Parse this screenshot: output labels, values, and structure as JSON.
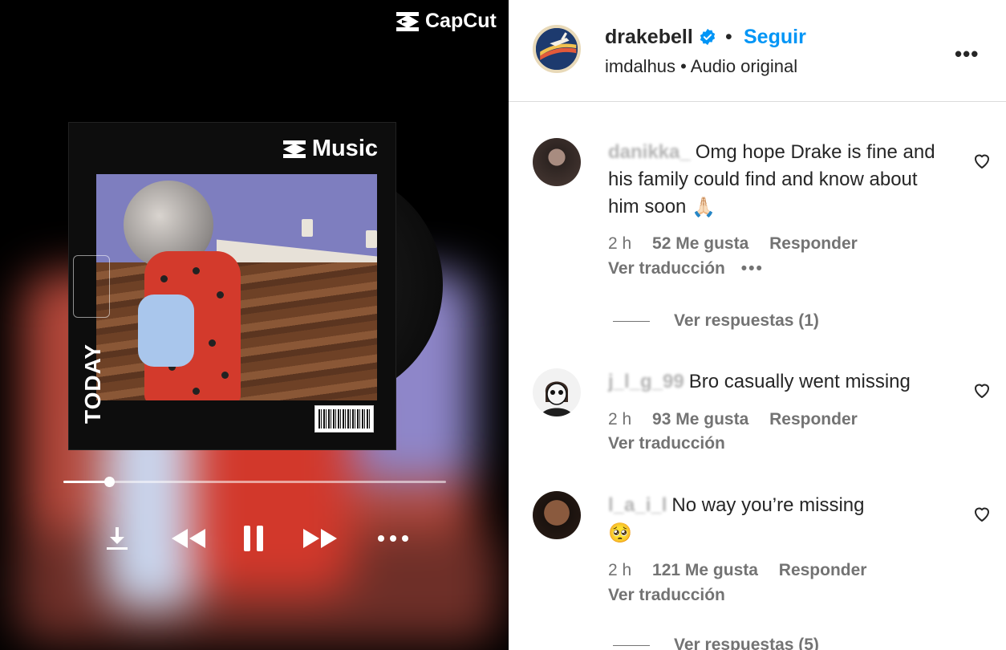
{
  "media": {
    "watermark": "CapCut",
    "album_brand": "Music",
    "album_side_text": "TODAY",
    "progress_fraction": 0.12
  },
  "post": {
    "username": "drakebell",
    "follow_label": "Seguir",
    "audio_author": "imdalhus",
    "audio_label": "Audio original",
    "more_label": "•••"
  },
  "comments": [
    {
      "username": "danikka_",
      "text": "Omg hope Drake is fine and his family could find and know about him soon",
      "emoji": "🙏🏻",
      "time": "2 h",
      "likes": "52 Me gusta",
      "reply_label": "Responder",
      "translate_label": "Ver traducción",
      "options_label": "•••",
      "replies_label": "Ver respuestas (1)"
    },
    {
      "username": "j_l_g_99",
      "text": "Bro casually went missing",
      "time": "2 h",
      "likes": "93 Me gusta",
      "reply_label": "Responder",
      "translate_label": "Ver traducción"
    },
    {
      "username": "l_a_i_l",
      "text": "No way you’re missing",
      "emoji": "🥺",
      "time": "2 h",
      "likes": "121 Me gusta",
      "reply_label": "Responder",
      "translate_label": "Ver traducción",
      "replies_label": "Ver respuestas (5)"
    }
  ],
  "colors": {
    "accent": "#0095f6",
    "text": "#262626",
    "muted": "#737373"
  }
}
